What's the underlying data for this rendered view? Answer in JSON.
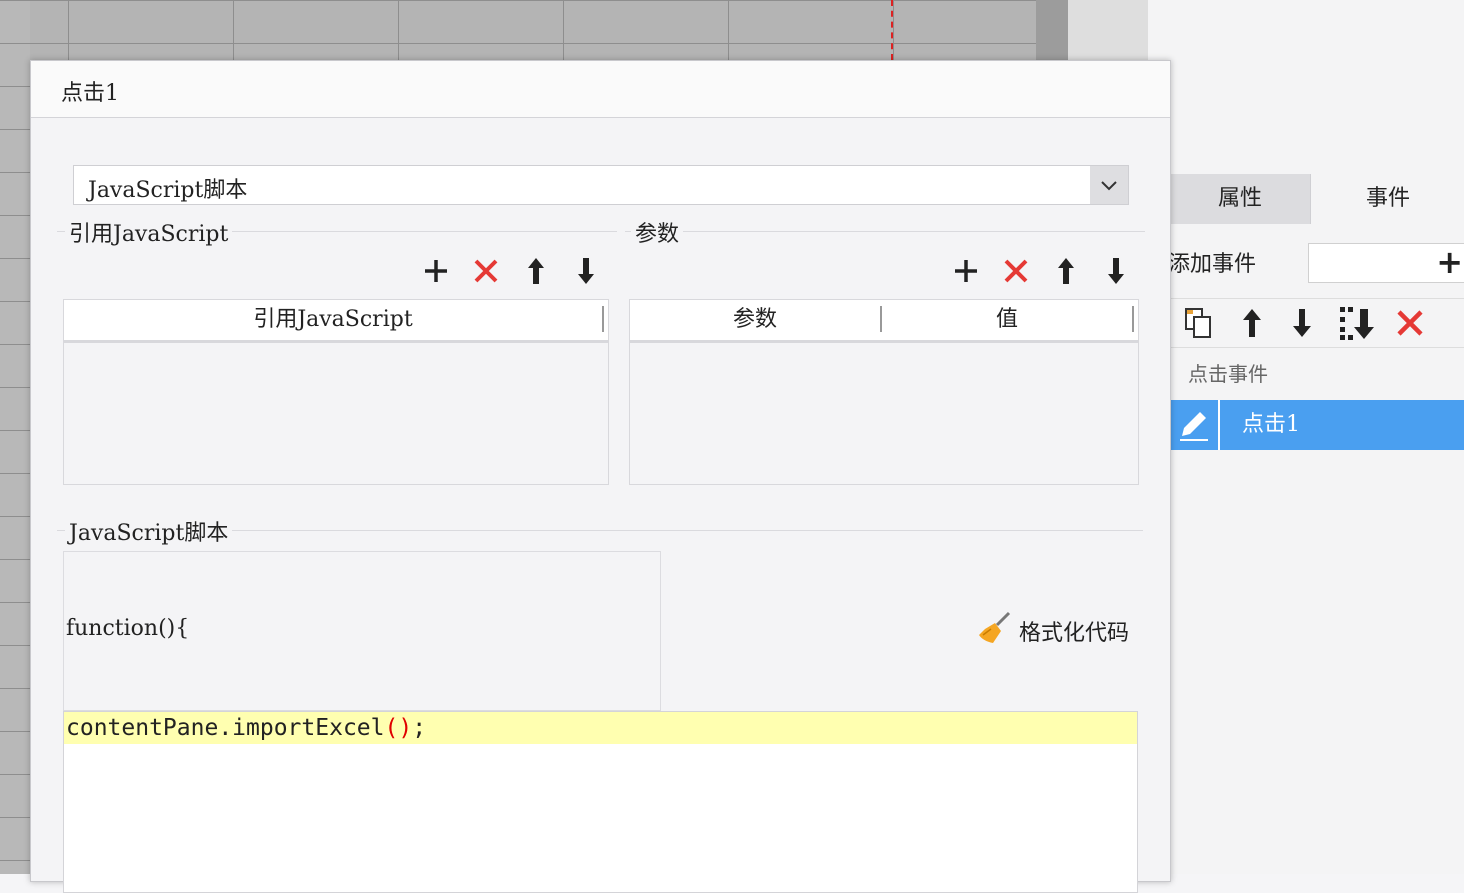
{
  "dialog": {
    "title": "点击1",
    "type_select": "JavaScript脚本",
    "ref_js": {
      "section_label": "引用JavaScript",
      "column_header": "引用JavaScript"
    },
    "params": {
      "section_label": "参数",
      "columns": [
        "参数",
        "值"
      ]
    },
    "script": {
      "section_label": "JavaScript脚本",
      "function_header": "function(){",
      "code_prefix": "contentPane.importExcel",
      "code_paren": "()",
      "code_suffix": ";",
      "format_button": "格式化代码"
    },
    "toolbar_icons": [
      "plus-icon",
      "delete-icon",
      "arrow-up-icon",
      "arrow-down-icon"
    ]
  },
  "right_panel": {
    "tabs": [
      "属性",
      "事件"
    ],
    "add_event_label": "添加事件",
    "group_label": "点击事件",
    "selected_event": "点击1",
    "toolbar_icons": [
      "copy-icon",
      "arrow-up-icon",
      "arrow-down-icon",
      "move-bottom-icon",
      "delete-icon"
    ]
  },
  "colors": {
    "selection": "#4a9ff0",
    "delete": "#e53935",
    "code_highlight": "#ffffb0",
    "code_paren": "#e00000"
  }
}
